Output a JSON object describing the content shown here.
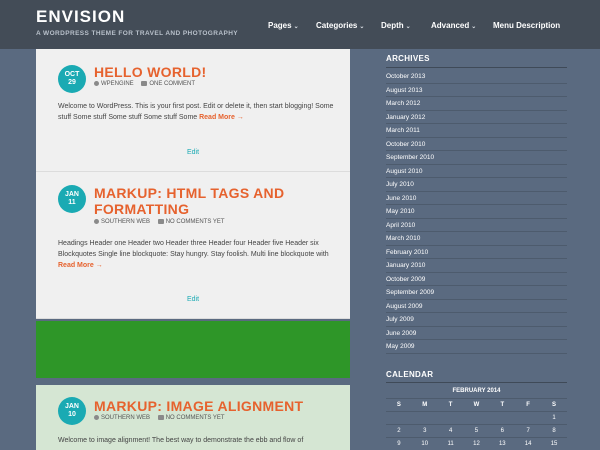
{
  "site": {
    "title": "ENVISION",
    "description": "A WORDPRESS THEME FOR TRAVEL AND PHOTOGRAPHY"
  },
  "nav": {
    "items": [
      {
        "label": "Pages",
        "has_dropdown": true
      },
      {
        "label": "Categories",
        "has_dropdown": true
      },
      {
        "label": "Depth",
        "has_dropdown": true
      },
      {
        "label": "Advanced",
        "has_dropdown": true
      },
      {
        "label": "Menu Description",
        "has_dropdown": false
      }
    ],
    "chevron": "⌄"
  },
  "posts": [
    {
      "month": "OCT",
      "day": "29",
      "title_line1": "HELLO WORLD!",
      "title_line2": "",
      "author": "WPENGINE",
      "comments": "ONE COMMENT",
      "excerpt": "Welcome to WordPress. This is your first post. Edit or delete it, then start blogging!   Some stuff Some stuff Some stuff Some stuff Some ",
      "read_more": "Read More →",
      "edit": "Edit"
    },
    {
      "month": "JAN",
      "day": "11",
      "title_line1": "MARKUP: HTML TAGS AND",
      "title_line2": "FORMATTING",
      "author": "SOUTHERN WEB",
      "comments": "NO COMMENTS YET",
      "excerpt": "Headings Header one Header two Header three Header four Header five Header six Blockquotes Single line blockquote: Stay hungry. Stay foolish. Multi line blockquote with ",
      "read_more": "Read More →",
      "edit": "Edit"
    },
    {
      "month": "JAN",
      "day": "10",
      "title_line1": "MARKUP: IMAGE ALIGNMENT",
      "title_line2": "",
      "author": "SOUTHERN WEB",
      "comments": "NO COMMENTS YET",
      "excerpt": "Welcome to image alignment! The best way to demonstrate the ebb and flow of"
    }
  ],
  "colors": {
    "accent_orange": "#e6622e",
    "accent_teal": "#1aaab3",
    "featured_green": "#2e9628",
    "background": "#5a6a80"
  },
  "archives": {
    "title": "ARCHIVES",
    "items": [
      "October 2013",
      "August 2013",
      "March 2012",
      "January 2012",
      "March 2011",
      "October 2010",
      "September 2010",
      "August 2010",
      "July 2010",
      "June 2010",
      "May 2010",
      "April 2010",
      "March 2010",
      "February 2010",
      "January 2010",
      "October 2009",
      "September 2009",
      "August 2009",
      "July 2009",
      "June 2009",
      "May 2009"
    ]
  },
  "calendar": {
    "title": "CALENDAR",
    "caption": "FEBRUARY 2014",
    "weekdays": [
      "S",
      "M",
      "T",
      "W",
      "T",
      "F",
      "S"
    ],
    "weeks": [
      [
        "",
        "",
        "",
        "",
        "",
        "",
        "1"
      ],
      [
        "2",
        "3",
        "4",
        "5",
        "6",
        "7",
        "8"
      ],
      [
        "9",
        "10",
        "11",
        "12",
        "13",
        "14",
        "15"
      ]
    ]
  }
}
